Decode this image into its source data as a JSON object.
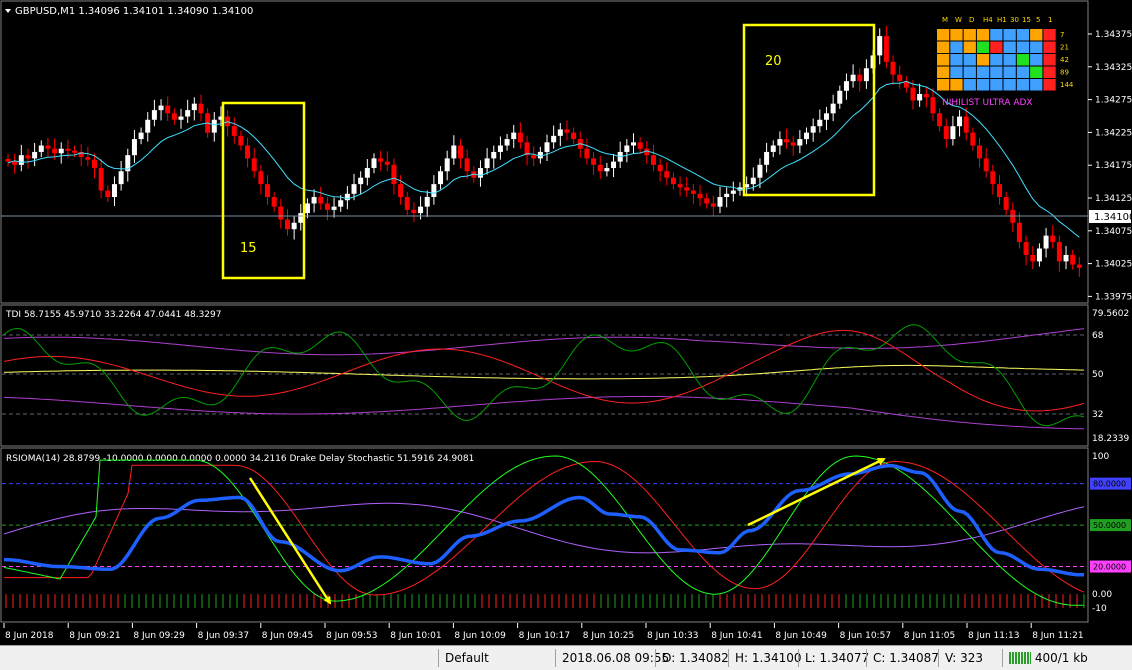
{
  "main_panel": {
    "symbol_header": "GBPUSD,M1  1.34096 1.34101 1.34090 1.34100",
    "price_labels": [
      "1.34375",
      "1.34325",
      "1.34275",
      "1.34225",
      "1.34175",
      "1.34125",
      "1.34075",
      "1.34025",
      "1.33975"
    ],
    "current_price": "1.34100",
    "box_labels": [
      "15",
      "20"
    ],
    "dashboard": {
      "columns": [
        "M",
        "W",
        "D",
        "H4",
        "H1",
        "30",
        "15",
        "5",
        "1"
      ],
      "rows": [
        "7",
        "21",
        "42",
        "89",
        "144"
      ],
      "title": "NIHILIST ULTRA ADX"
    }
  },
  "tdi_panel": {
    "header": "TDI 58.7155 45.9710 33.2264 47.0441 48.3297",
    "levels": [
      "79.5602",
      "68",
      "50",
      "32",
      "18.2339"
    ]
  },
  "rsioma_panel": {
    "header": "RSIOMA(14) 28.8799 -10.0000 0.0000 0.0000 0.0000 34.2116  Drake Delay Stochastic 51.5916 24.9081",
    "levels_plain": [
      "100",
      "0.00",
      "-10"
    ],
    "levels_boxed": [
      "80.0000",
      "50.0000",
      "20.0000"
    ]
  },
  "time_axis": [
    "8 Jun 2018",
    "8 Jun 09:21",
    "8 Jun 09:29",
    "8 Jun 09:37",
    "8 Jun 09:45",
    "8 Jun 09:53",
    "8 Jun 10:01",
    "8 Jun 10:09",
    "8 Jun 10:17",
    "8 Jun 10:25",
    "8 Jun 10:33",
    "8 Jun 10:41",
    "8 Jun 10:49",
    "8 Jun 10:57",
    "8 Jun 11:05",
    "8 Jun 11:13",
    "8 Jun 11:21"
  ],
  "status_bar": {
    "profile": "Default",
    "datetime": "2018.06.08 09:55",
    "open": "O: 1.34082",
    "high": "H: 1.34100",
    "low": "L: 1.34077",
    "close": "C: 1.34087",
    "volume": "V: 323",
    "traffic": "400/1 kb"
  },
  "colors": {
    "bull": "#ffffff",
    "bear": "#ff0000",
    "ma": "#40e0ff",
    "annotation": "#ffff00",
    "tdi_green": "#00a000",
    "tdi_red": "#ff2020",
    "tdi_yellow": "#ffff60",
    "tdi_band": "#b040d0",
    "rsioma": "#1e60ff",
    "stoch_green": "#20ff20",
    "stoch_red": "#ff2020",
    "violet": "#b060ff"
  },
  "series": {
    "price_close": [
      1.34175,
      1.3417,
      1.34185,
      1.3418,
      1.3419,
      1.342,
      1.34195,
      1.34188,
      1.34195,
      1.34192,
      1.3419,
      1.34182,
      1.34178,
      1.34165,
      1.3413,
      1.3412,
      1.3414,
      1.3416,
      1.34185,
      1.3421,
      1.3422,
      1.3424,
      1.34255,
      1.34262,
      1.3425,
      1.3424,
      1.34245,
      1.34255,
      1.34265,
      1.3425,
      1.3422,
      1.3424,
      1.34245,
      1.3423,
      1.34215,
      1.342,
      1.3418,
      1.3416,
      1.3414,
      1.3412,
      1.34105,
      1.34085,
      1.3407,
      1.3408,
      1.34095,
      1.3411,
      1.3412,
      1.3411,
      1.341,
      1.34105,
      1.34115,
      1.34125,
      1.3414,
      1.3415,
      1.34165,
      1.3418,
      1.34175,
      1.3417,
      1.3414,
      1.3412,
      1.341,
      1.34095,
      1.34105,
      1.3412,
      1.3414,
      1.3416,
      1.3418,
      1.342,
      1.3418,
      1.3416,
      1.3415,
      1.34165,
      1.3418,
      1.3419,
      1.342,
      1.3421,
      1.3422,
      1.34205,
      1.34185,
      1.3418,
      1.3419,
      1.34205,
      1.34215,
      1.34225,
      1.3422,
      1.3421,
      1.34195,
      1.3418,
      1.3417,
      1.3416,
      1.34165,
      1.34175,
      1.3419,
      1.342,
      1.34205,
      1.34195,
      1.34185,
      1.3417,
      1.3416,
      1.3415,
      1.3414,
      1.34135,
      1.3413,
      1.34125,
      1.34118,
      1.3411,
      1.34105,
      1.3412,
      1.34125,
      1.3413,
      1.34135,
      1.3414,
      1.3415,
      1.3417,
      1.3419,
      1.342,
      1.3421,
      1.34205,
      1.342,
      1.3421,
      1.3422,
      1.3423,
      1.3424,
      1.3425,
      1.34265,
      1.34285,
      1.343,
      1.3431,
      1.343,
      1.3432,
      1.3434,
      1.3437,
      1.3433,
      1.3431,
      1.343,
      1.3429,
      1.3427,
      1.3428,
      1.34275,
      1.3425,
      1.3423,
      1.3421,
      1.3423,
      1.34245,
      1.3422,
      1.342,
      1.3418,
      1.3416,
      1.3414,
      1.3412,
      1.341,
      1.3408,
      1.3405,
      1.3403,
      1.3402,
      1.3404,
      1.3406,
      1.3405,
      1.3402,
      1.3403,
      1.34015,
      1.3401
    ]
  }
}
